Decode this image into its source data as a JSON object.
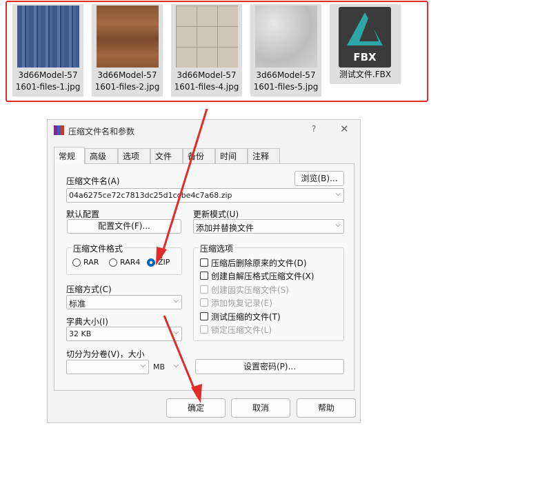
{
  "files": [
    {
      "name": "3d66Model-57\n1601-files-1.jpg"
    },
    {
      "name": "3d66Model-57\n1601-files-2.jpg"
    },
    {
      "name": "3d66Model-57\n1601-files-4.jpg"
    },
    {
      "name": "3d66Model-57\n1601-files-5.jpg"
    },
    {
      "name": "测试文件.FBX",
      "badge": "FBX"
    }
  ],
  "dialog": {
    "title": "压缩文件名和参数",
    "help": "?",
    "close": "✕",
    "tabs": [
      "常规",
      "高级",
      "选项",
      "文件",
      "备份",
      "时间",
      "注释"
    ],
    "archive_name_label": "压缩文件名(A)",
    "browse_button": "浏览(B)...",
    "archive_name_value": "04a6275ce72c7813dc25d1ccbe4c7a68.zip",
    "default_profile_label": "默认配置",
    "profile_button": "配置文件(F)...",
    "update_mode_label": "更新模式(U)",
    "update_mode_value": "添加并替换文件",
    "format_label": "压缩文件格式",
    "formats": [
      "RAR",
      "RAR4",
      "ZIP"
    ],
    "selected_format": "ZIP",
    "method_label": "压缩方式(C)",
    "method_value": "标准",
    "dict_label": "字典大小(I)",
    "dict_value": "32 KB",
    "split_label": "切分为分卷(V)，大小",
    "split_value": "",
    "split_unit": "MB",
    "password_button": "设置密码(P)...",
    "options_label": "压缩选项",
    "options": [
      {
        "label": "压缩后删除原来的文件(D)",
        "enabled": true,
        "checked": false
      },
      {
        "label": "创建自解压格式压缩文件(X)",
        "enabled": true,
        "checked": false
      },
      {
        "label": "创建固实压缩文件(S)",
        "enabled": false,
        "checked": false
      },
      {
        "label": "添加恢复记录(E)",
        "enabled": false,
        "checked": false
      },
      {
        "label": "测试压缩的文件(T)",
        "enabled": true,
        "checked": false
      },
      {
        "label": "锁定压缩文件(L)",
        "enabled": false,
        "checked": false
      }
    ],
    "ok_button": "确定",
    "cancel_button": "取消",
    "help_button": "帮助"
  },
  "annotation_color": "#e22a2a",
  "accent_color": "#0067c0"
}
